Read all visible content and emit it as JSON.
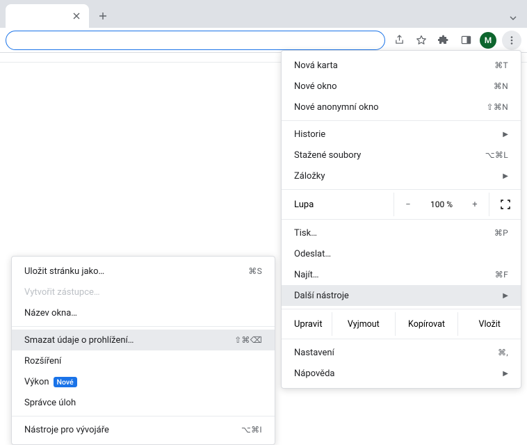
{
  "tab": {
    "title": ""
  },
  "avatar": {
    "initial": "M"
  },
  "menu": {
    "new_tab": "Nová karta",
    "new_tab_acc": "⌘T",
    "new_window": "Nové okno",
    "new_window_acc": "⌘N",
    "incognito": "Nové anonymní okno",
    "incognito_acc": "⇧⌘N",
    "history": "Historie",
    "downloads": "Stažené soubory",
    "downloads_acc": "⌥⌘L",
    "bookmarks": "Záložky",
    "zoom_label": "Lupa",
    "zoom_value": "100 %",
    "print": "Tisk…",
    "print_acc": "⌘P",
    "cast": "Odeslat…",
    "find": "Najít…",
    "find_acc": "⌘F",
    "more_tools": "Další nástroje",
    "edit_label": "Upravit",
    "cut": "Vyjmout",
    "copy": "Kopírovat",
    "paste": "Vložit",
    "settings": "Nastavení",
    "settings_acc": "⌘,",
    "help": "Nápověda"
  },
  "submenu": {
    "save_as": "Uložit stránku jako…",
    "save_as_acc": "⌘S",
    "create_shortcut": "Vytvořit zástupce…",
    "name_window": "Název okna…",
    "clear_data": "Smazat údaje o prohlížení…",
    "clear_data_acc": "⇧⌘⌫",
    "extensions": "Rozšíření",
    "performance": "Výkon",
    "performance_badge": "Nové",
    "task_manager": "Správce úloh",
    "dev_tools": "Nástroje pro vývojáře",
    "dev_tools_acc": "⌥⌘I"
  }
}
